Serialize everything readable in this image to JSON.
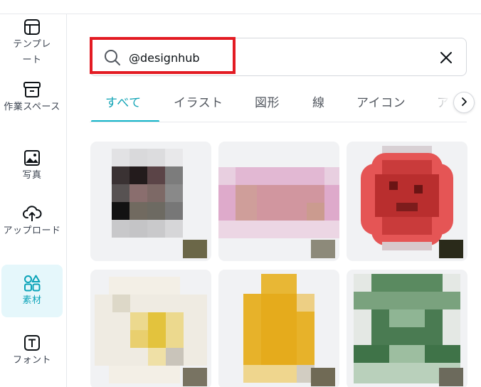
{
  "sidebar": {
    "items": [
      {
        "label": "テンプレート",
        "icon": "template-icon"
      },
      {
        "label": "作業スペース",
        "icon": "archive-icon"
      },
      {
        "label": "写真",
        "icon": "image-icon"
      },
      {
        "label": "アップロード",
        "icon": "cloud-upload-icon"
      },
      {
        "label": "素材",
        "icon": "elements-icon",
        "active": true
      },
      {
        "label": "フォント",
        "icon": "text-icon"
      }
    ]
  },
  "search": {
    "value": "@designhub",
    "icon": "search-icon",
    "clear_icon": "close-icon"
  },
  "tabs": [
    {
      "label": "すべて",
      "active": true
    },
    {
      "label": "イラスト"
    },
    {
      "label": "図形"
    },
    {
      "label": "線"
    },
    {
      "label": "アイコン"
    },
    {
      "label": "アニ"
    }
  ],
  "colors": {
    "accent": "#12a4b6",
    "highlight": "#e31b23"
  },
  "results": [
    {
      "name": "dark-photo"
    },
    {
      "name": "pink-banner"
    },
    {
      "name": "red-circle"
    },
    {
      "name": "white-yellow"
    },
    {
      "name": "yellow-egg"
    },
    {
      "name": "green-grid"
    }
  ]
}
